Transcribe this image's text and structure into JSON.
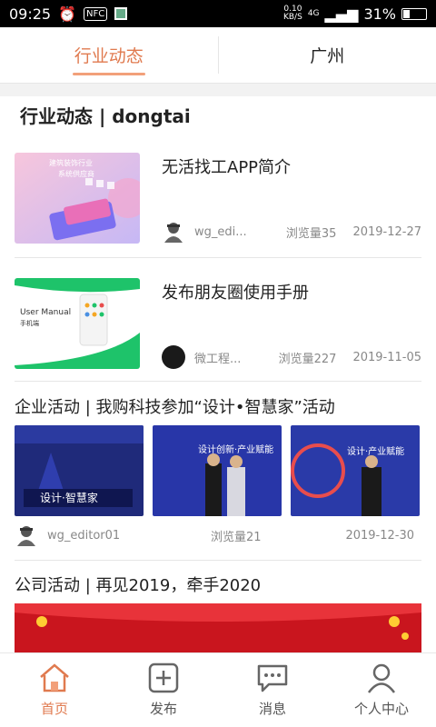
{
  "status_bar": {
    "time": "09:25",
    "nfc": "NFC",
    "net_speed_top": "0.10",
    "net_speed_bottom": "KB/S",
    "network": "4G",
    "battery": "31%",
    "battery_level": 0.31
  },
  "tabs": [
    {
      "label": "行业动态",
      "active": true
    },
    {
      "label": "广州",
      "active": false
    }
  ],
  "section_title": "行业动态 | dongtai",
  "articles": [
    {
      "title": "无活找工APP简介",
      "thumb_caption_1": "建筑装饰行业",
      "thumb_caption_2": "系统供应商",
      "author": "wg_edi...",
      "views": "浏览量35",
      "date": "2019-12-27"
    },
    {
      "title": "发布朋友圈使用手册",
      "thumb_caption_1": "User Manual",
      "thumb_caption_2": "手机端",
      "author": "微工程...",
      "views": "浏览量227",
      "date": "2019-11-05"
    }
  ],
  "gallery_post": {
    "title": "企业活动 | 我购科技参加“设计•智慧家”活动",
    "img1_text": "设计·智慧家",
    "img2_text": "设计创新·产业赋能",
    "img3_text": "设计·产业赋能",
    "author": "wg_editor01",
    "views": "浏览量21",
    "date": "2019-12-30"
  },
  "next_post": {
    "title": "公司活动 | 再见2019，牵手2020"
  },
  "bottom_nav": [
    {
      "label": "首页",
      "icon": "home-icon",
      "active": true
    },
    {
      "label": "发布",
      "icon": "plus-square-icon",
      "active": false
    },
    {
      "label": "消息",
      "icon": "message-icon",
      "active": false
    },
    {
      "label": "个人中心",
      "icon": "user-icon",
      "active": false
    }
  ],
  "colors": {
    "accent": "#e07a4f",
    "text": "#222222",
    "meta": "#888888"
  }
}
